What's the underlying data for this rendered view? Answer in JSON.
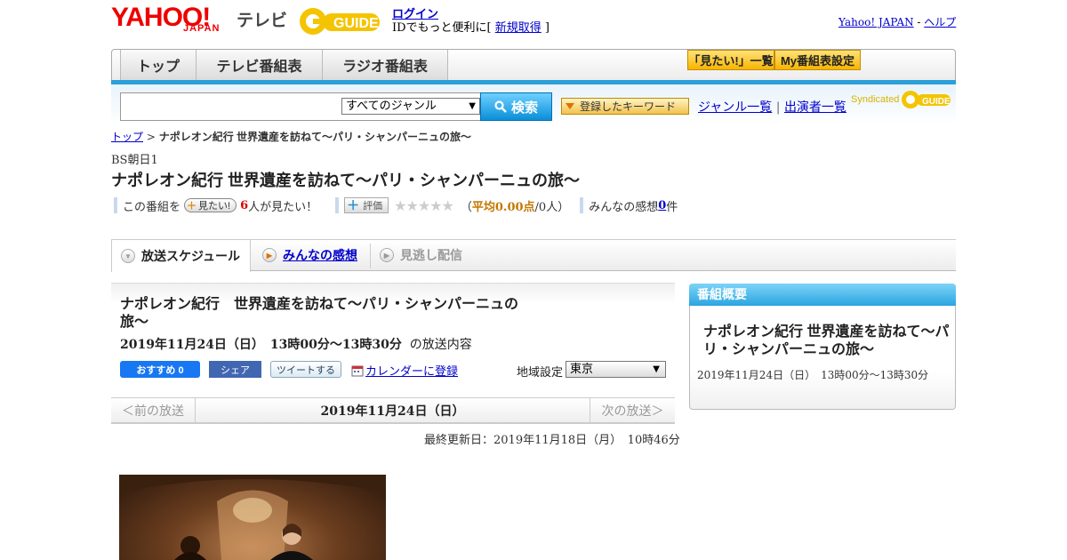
{
  "header": {
    "logo_yahoo": "YAHOO!",
    "logo_japan": "JAPAN",
    "logo_tv": "テレビ",
    "gguide": "GUIDE",
    "login": "ログイン",
    "login_sub_prefix": "IDでもっと便利に[ ",
    "login_sub_link": "新規取得",
    "login_sub_suffix": " ]",
    "yahoo_japan": "Yahoo! JAPAN",
    "dash": " - ",
    "help": "ヘルプ"
  },
  "nav": {
    "tabs": [
      "トップ",
      "テレビ番組表",
      "ラジオ番組表"
    ],
    "mitai_list": "「見たい!」一覧",
    "my_schedule": "My番組表設定"
  },
  "search": {
    "genre": "すべてのジャンル",
    "button": "検索",
    "keyword": "登録したキーワード",
    "genre_list": "ジャンル一覧",
    "sep": " | ",
    "cast_list": "出演者一覧",
    "syndicated": "Syndicated"
  },
  "breadcrumb": {
    "top": "トップ",
    "arrow": " > ",
    "current": "ナポレオン紀行 世界遺産を訪ねて～パリ・シャンパーニュの旅～"
  },
  "program": {
    "channel": "BS朝日1",
    "title": "ナポレオン紀行 世界遺産を訪ねて～パリ・シャンパーニュの旅～",
    "this_program": "この番組を",
    "mitai_btn": "見たい!",
    "mitai_count": "6",
    "mitai_suffix": "人が見たい！",
    "rate_btn": "評価",
    "stars": "★★★★★",
    "avg_open": "（",
    "avg_label": "平均0.00点",
    "avg_suffix": "/0人）",
    "impressions": "みんなの感想 ",
    "impressions_count": "0",
    "impressions_unit": "件"
  },
  "tabs": {
    "schedule": "放送スケジュール",
    "impressions": "みんなの感想",
    "vod": "見逃し配信"
  },
  "schedule": {
    "name": "ナポレオン紀行　世界遺産を訪ねて～パリ・シャンパーニュの旅～",
    "datetime": "2019年11月24日（日）　13時00分～13時30分",
    "datetime_suffix": "の放送内容",
    "fb_recommend": "おすすめ 0",
    "fb_share": "シェア",
    "tweet": "ツイートする",
    "calendar": "カレンダーに登録",
    "region_label": "地域設定",
    "region": "東京",
    "prev": "＜前の放送",
    "date": "2019年11月24日（日）",
    "next": "次の放送＞",
    "updated": "最終更新日：2019年11月18日（月）　10時46分"
  },
  "panel": {
    "header": "番組概要",
    "title": "ナポレオン紀行 世界遺産を訪ねて～パリ・シャンパーニュの旅～",
    "time": "2019年11月24日（日）　13時00分～13時30分"
  },
  "colors": {
    "accent_blue": "#2a9fd8",
    "link": "#0000cc",
    "red": "#dd0000",
    "gold": "#f7b500"
  }
}
